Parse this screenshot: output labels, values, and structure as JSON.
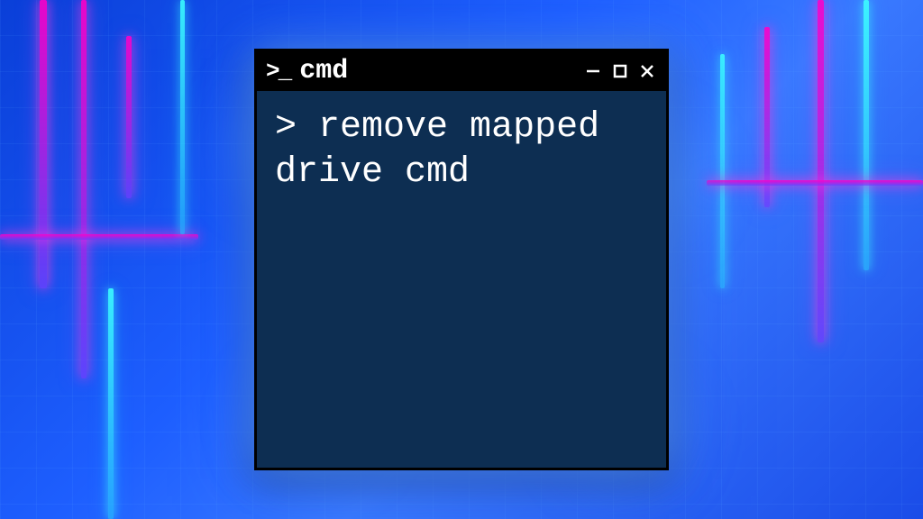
{
  "window": {
    "icon_text": ">_",
    "title": "cmd"
  },
  "terminal": {
    "prompt": ">",
    "command": "remove mapped drive cmd"
  }
}
